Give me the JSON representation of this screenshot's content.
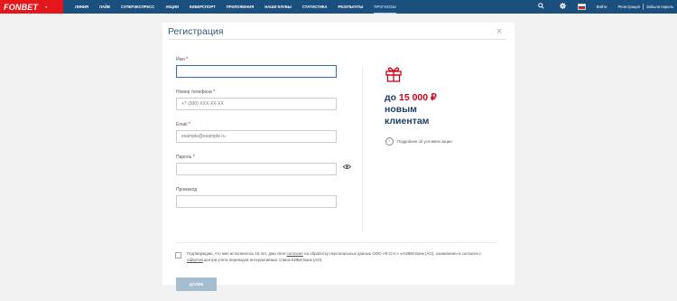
{
  "brand": {
    "name": "FONBET",
    "caret": "▾"
  },
  "nav": [
    {
      "label": "ЛИНИЯ"
    },
    {
      "label": "ЛАЙВ"
    },
    {
      "label": "СУПЕРЭКСПРЕСС"
    },
    {
      "label": "АКЦИИ"
    },
    {
      "label": "КИБЕРСПОРТ"
    },
    {
      "label": "ПРИЛОЖЕНИЯ"
    },
    {
      "label": "НАШИ КЛУБЫ"
    },
    {
      "label": "СТАТИСТИКА"
    },
    {
      "label": "РЕЗУЛЬТАТЫ"
    },
    {
      "label": "ПРОГНОЗЫ"
    }
  ],
  "top_right": {
    "search_icon": "search-icon",
    "settings_icon": "gear-icon",
    "login": "Войти",
    "register": "Регистрация",
    "forgot": "Забыли пароль"
  },
  "colors": {
    "header": "#1b4f7e",
    "brand_red": "#e3171c",
    "promo_red": "#d0021b",
    "button_disabled": "#a5bdd0"
  },
  "form": {
    "title": "Регистрация",
    "close_glyph": "×",
    "fields": [
      {
        "label": "Имя",
        "required": "*",
        "value": "",
        "placeholder": ""
      },
      {
        "label": "Номер телефона",
        "required": "*",
        "value": "",
        "placeholder": "+7 (000) XXX-XX-XX"
      },
      {
        "label": "Email",
        "required": "*",
        "value": "",
        "placeholder": "example@example.ru"
      },
      {
        "label": "Пароль",
        "required": "*",
        "value": "",
        "placeholder": ""
      },
      {
        "label": "Промокод",
        "required": "",
        "value": "",
        "placeholder": ""
      }
    ],
    "consent_part1": "Подтверждаю, что мне исполнилось 18 лет, даю свое ",
    "consent_link1": "согласие",
    "consent_part2": " на обработку персональных данных ООО «Ф.О.Н.» и КИВИ Банк (АО), ознакомлен и согласен с ",
    "consent_link2": "офертой",
    "consent_part3": " центра учета переводов интерактивных ставок КИВИ Банк (АО).",
    "submit": "ДАЛЕЕ"
  },
  "promo": {
    "prefix": "до ",
    "amount": "15 000 ₽",
    "line2": "новым",
    "line3": "клиентам",
    "info_glyph": "i",
    "info_text": "Подробнее об условиях акции"
  }
}
